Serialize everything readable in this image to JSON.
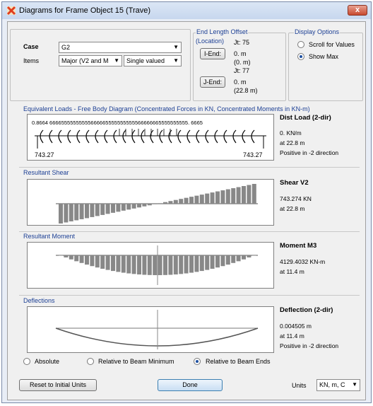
{
  "window": {
    "title": "Diagrams for Frame Object 15  (Trave)",
    "close_glyph": "x"
  },
  "case": {
    "label": "Case",
    "value": "G2"
  },
  "items": {
    "label": "Items",
    "value": "Major (V2 and M",
    "mode_value": "Single valued"
  },
  "end_offset": {
    "group_label": "End Length Offset",
    "location_label": "(Location)",
    "i_end": {
      "button": "I-End:",
      "jt": "Jt: 75",
      "value": "0. m",
      "location": "(0. m)"
    },
    "j_end": {
      "button": "J-End:",
      "jt": "Jt: 77",
      "value": "0. m",
      "location": "(22.8 m)"
    }
  },
  "display_options": {
    "label": "Display Options",
    "scroll_label": "Scroll for Values",
    "scroll_selected": false,
    "max_label": "Show Max",
    "max_selected": true
  },
  "loads": {
    "section_label": "Equivalent Loads - Free Body Diagram  (Concentrated Forces in KN, Concentrated Moments in KN-m)",
    "top_text": "0.8664   66665555555555666665555555555566666665555555555. 6665",
    "left_value": "743.27",
    "right_value": "743.27",
    "panel_title": "Dist Load (2-dir)",
    "value": "0. KN/m",
    "at": "at 22.8 m",
    "direction": "Positive in -2 direction"
  },
  "shear": {
    "section_label": "Resultant Shear",
    "panel_title": "Shear V2",
    "value": "743.274 KN",
    "at": "at 22.8 m"
  },
  "moment": {
    "section_label": "Resultant Moment",
    "panel_title": "Moment M3",
    "value": "4129.4032 KN-m",
    "at": "at 11.4 m"
  },
  "deflection": {
    "section_label": "Deflections",
    "panel_title": "Deflection (2-dir)",
    "value": "0.004505 m",
    "at": "at 11.4 m",
    "direction": "Positive in -2 direction"
  },
  "deflection_options": {
    "absolute": "Absolute",
    "relative_min": "Relative to Beam Minimum",
    "relative_ends": "Relative to Beam Ends",
    "selected": "relative_ends"
  },
  "footer": {
    "reset_button": "Reset to Initial Units",
    "done_button": "Done",
    "units_label": "Units",
    "units_value": "KN, m, C"
  },
  "colors": {
    "accent_label": "#1c3f94",
    "diagram_fill": "#888888",
    "title_icon": "#e03c1e",
    "close_button": "#c84a30"
  }
}
